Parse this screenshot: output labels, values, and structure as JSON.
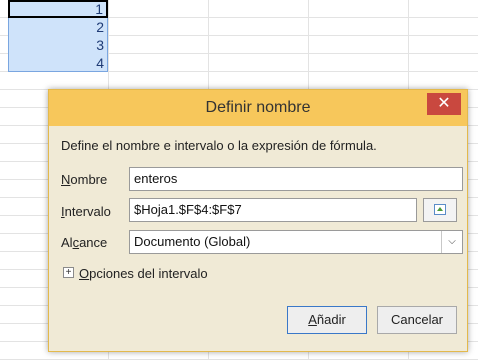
{
  "sheet": {
    "cells": [
      "1",
      "2",
      "3",
      "4"
    ]
  },
  "dialog": {
    "title": "Definir nombre",
    "close_symbol": "✕",
    "description": "Define el nombre e intervalo o la expresión de fórmula.",
    "name_label": {
      "pre": "",
      "key": "N",
      "post": "ombre"
    },
    "name_value": "enteros",
    "range_label": {
      "pre": "",
      "key": "I",
      "post": "ntervalo"
    },
    "range_value": "$Hoja1.$F$4:$F$7",
    "scope_label": {
      "pre": "Al",
      "key": "c",
      "post": "ance"
    },
    "scope_value": "Documento (Global)",
    "options_label": {
      "pre": "",
      "key": "O",
      "post": "pciones del intervalo"
    },
    "expander_symbol": "+",
    "add_button": {
      "pre": "",
      "key": "A",
      "post": "ñadir"
    },
    "cancel_button": "Cancelar"
  }
}
